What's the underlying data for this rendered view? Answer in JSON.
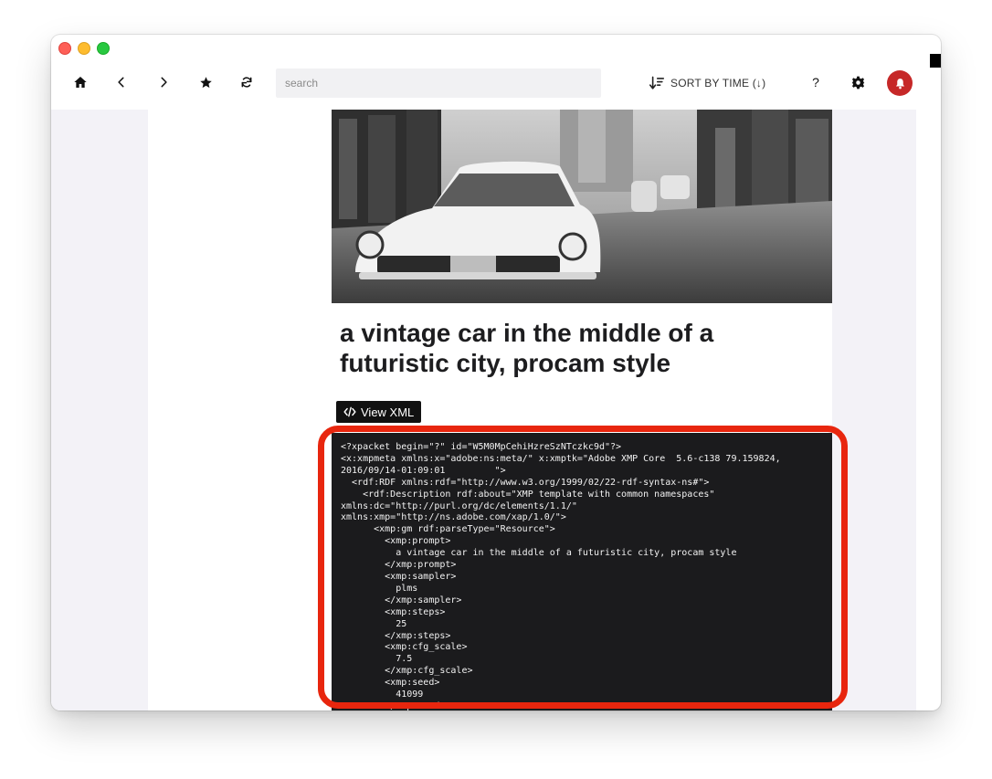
{
  "window": {
    "controls": [
      "close",
      "minimize",
      "zoom"
    ]
  },
  "toolbar": {
    "icons": [
      "home-icon",
      "chevron-left-icon",
      "chevron-right-icon",
      "star-icon",
      "refresh-icon",
      "sort-icon",
      "help-icon",
      "gear-icon",
      "bell-icon"
    ],
    "search_placeholder": "search",
    "search_value": "",
    "sort_label": "SORT BY TIME (↓)",
    "help_label": "?"
  },
  "colors": {
    "accent_red": "#c62828",
    "highlight": "#e8260e",
    "code_bg": "#1b1b1d"
  },
  "main": {
    "title": "a vintage car in the middle of a futuristic city, procam style",
    "view_xml_label": "View XML",
    "xml_lines": [
      "<?xpacket begin=\"?\" id=\"W5M0MpCehiHzreSzNTczkc9d\"?>",
      "<x:xmpmeta xmlns:x=\"adobe:ns:meta/\" x:xmptk=\"Adobe XMP Core  5.6-c138 79.159824,",
      "2016/09/14-01:09:01         \">",
      "  <rdf:RDF xmlns:rdf=\"http://www.w3.org/1999/02/22-rdf-syntax-ns#\">",
      "    <rdf:Description rdf:about=\"XMP template with common namespaces\"",
      "xmlns:dc=\"http://purl.org/dc/elements/1.1/\"",
      "xmlns:xmp=\"http://ns.adobe.com/xap/1.0/\">",
      "      <xmp:gm rdf:parseType=\"Resource\">",
      "        <xmp:prompt>",
      "          a vintage car in the middle of a futuristic city, procam style",
      "        </xmp:prompt>",
      "        <xmp:sampler>",
      "          plms",
      "        </xmp:sampler>",
      "        <xmp:steps>",
      "          25",
      "        </xmp:steps>",
      "        <xmp:cfg_scale>",
      "          7.5",
      "        </xmp:cfg_scale>",
      "        <xmp:seed>",
      "          41099",
      "        </xmp:seed>"
    ]
  }
}
